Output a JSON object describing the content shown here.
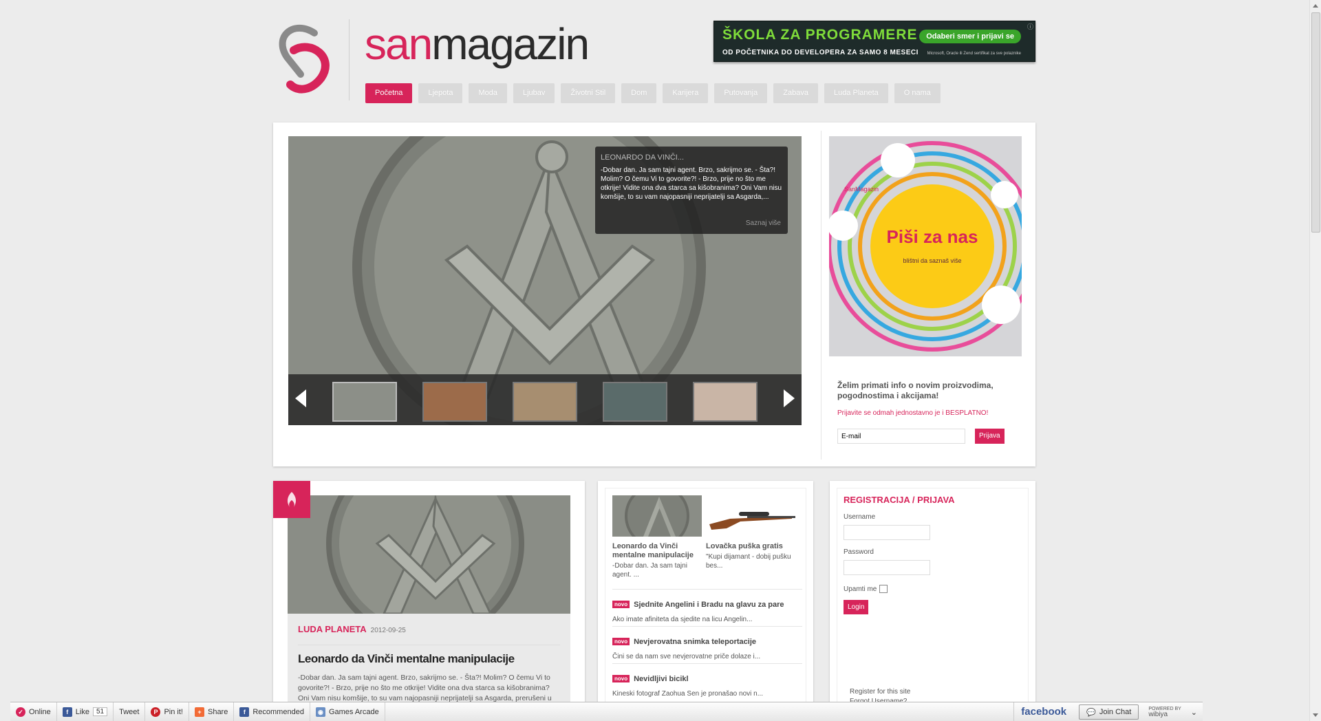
{
  "site": {
    "logo_san": "san",
    "logo_magazin": "magazin",
    "brand_color": "#d7245a"
  },
  "top_ad": {
    "title": "ŠKOLA ZA PROGRAMERE",
    "subtitle": "OD POČETNIKA DO DEVELOPERA ZA SAMO 8 MESECI",
    "cta": "Odaberi smer i prijavi se",
    "fine_print": "Microsoft, Oracle ili Zend sertifikat za sve polaznike"
  },
  "nav": [
    "Početna",
    "Ljepota",
    "Moda",
    "Ljubav",
    "Životni Stil",
    "Dom",
    "Karijera",
    "Putovanja",
    "Zabava",
    "Luda Planeta",
    "O nama"
  ],
  "slider": {
    "caption_title": "LEONARDO DA VINČI...",
    "caption_text": "-Dobar dan. Ja sam tajni agent. Brzo, sakrijmo se. - Šta?! Molim? O čemu Vi to govorite?! - Brzo, prije no što me otkrije! Vidite ona dva starca sa kišobranima? Oni Vam nisu komšije, to su vam najopasniji neprijatelji sa Asgarda,...",
    "caption_more": "Saznaj više"
  },
  "side_ad": {
    "brand": "SanMagazin",
    "headline": "Piši za nas",
    "sub": "blištni da saznaš više"
  },
  "newsletter": {
    "title": "Želim primati info o novim proizvodima, pogodnostima i akcijama!",
    "subtitle": "Prijavite se odmah jednostavno je i BESPLATNO!",
    "email_value": "E-mail",
    "button": "Prijava"
  },
  "featured": {
    "category": "LUDA PLANETA",
    "date": "2012-09-25",
    "title": "Leonardo da Vinči mentalne manipulacije",
    "text": "-Dobar dan. Ja sam tajni agent. Brzo, sakrijmo se. - Šta?! Molim? O čemu Vi to govorite?! - Brzo, prije no što me otkrije! Vidite ona dva starca sa kišobranima? Oni Vam nisu komšije, to su vam najopasniji neprijatelji sa Asgarda, prerušeni u ljudski rod, a u stvari su opasni ...."
  },
  "minis": [
    {
      "title": "Leonardo da Vinči mentalne manipulacije",
      "text": "-Dobar dan. Ja sam tajni agent. ..."
    },
    {
      "title": "Lovačka puška gratis",
      "text": "\"Kupi dijamant - dobij pušku bes..."
    }
  ],
  "news_badge": "novo",
  "news": [
    {
      "title": "Sjednite Angelini i Bradu na glavu za pare",
      "text": "Ako imate afiniteta da sjedite na licu Angelin..."
    },
    {
      "title": "Nevjerovatna snimka teleportacije",
      "text": "Čini se da nam sve nevjerovatne priče dolaze i..."
    },
    {
      "title": "Nevidljivi bicikl",
      "text": "Kineski fotograf Zaohua Sen je pronašao novi n..."
    }
  ],
  "login": {
    "title": "REGISTRACIJA / PRIJAVA",
    "username_label": "Username",
    "password_label": "Password",
    "remember": "Upamti me",
    "button": "Login",
    "register_link": "Register for this site",
    "forgot_link": "Forgot Username?"
  },
  "toolbar": {
    "online": "Online",
    "like": "Like",
    "like_count": "51",
    "tweet": "Tweet",
    "pin": "Pin it!",
    "share": "Share",
    "recommended": "Recommended",
    "games": "Games Arcade",
    "facebook": "facebook",
    "join_chat": "Join Chat",
    "powered": "POWERED BY",
    "wibiya": "wibiya"
  }
}
